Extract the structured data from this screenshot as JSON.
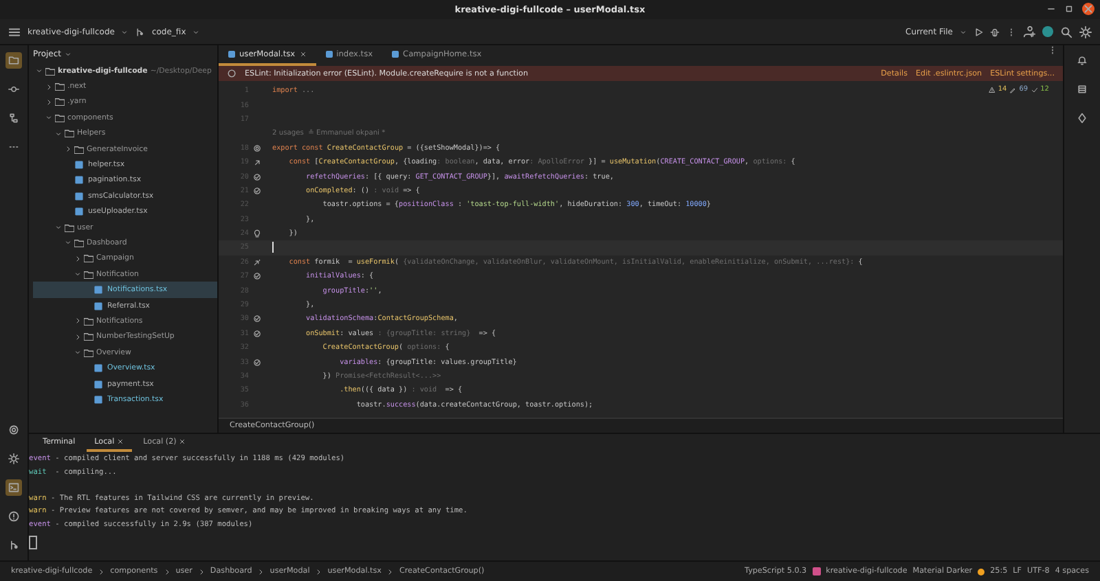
{
  "window": {
    "title": "kreative-digi-fullcode – userModal.tsx"
  },
  "toolbar": {
    "project": "kreative-digi-fullcode",
    "branch": "code_fix",
    "run_config": "Current File"
  },
  "project_panel": {
    "title": "Project",
    "tree": [
      {
        "name": "kreative-digi-fullcode",
        "path": "~/Desktop/Deep",
        "kind": "folder",
        "expanded": true,
        "selected": false,
        "children": [
          {
            "name": ".next",
            "kind": "folder",
            "expanded": false,
            "selected": false
          },
          {
            "name": ".yarn",
            "kind": "folder",
            "expanded": false,
            "selected": false
          },
          {
            "name": "components",
            "kind": "folder",
            "expanded": true,
            "selected": false,
            "children": [
              {
                "name": "Helpers",
                "kind": "folder",
                "expanded": true,
                "selected": false,
                "children": [
                  {
                    "name": "GenerateInvoice",
                    "kind": "folder",
                    "expanded": false,
                    "selected": false
                  },
                  {
                    "name": "helper.tsx",
                    "kind": "file",
                    "selected": false,
                    "modified": false
                  },
                  {
                    "name": "pagination.tsx",
                    "kind": "file",
                    "selected": false,
                    "modified": false
                  },
                  {
                    "name": "smsCalculator.tsx",
                    "kind": "file",
                    "selected": false,
                    "modified": false
                  },
                  {
                    "name": "useUploader.tsx",
                    "kind": "file",
                    "selected": false,
                    "modified": false
                  }
                ]
              },
              {
                "name": "user",
                "kind": "folder",
                "expanded": true,
                "selected": false,
                "children": [
                  {
                    "name": "Dashboard",
                    "kind": "folder",
                    "expanded": true,
                    "selected": false,
                    "children": [
                      {
                        "name": "Campaign",
                        "kind": "folder",
                        "expanded": false,
                        "selected": false
                      },
                      {
                        "name": "Notification",
                        "kind": "folder",
                        "expanded": true,
                        "selected": false,
                        "children": [
                          {
                            "name": "Notifications.tsx",
                            "kind": "file",
                            "selected": true,
                            "modified": true
                          },
                          {
                            "name": "Referral.tsx",
                            "kind": "file",
                            "selected": false,
                            "modified": false
                          }
                        ]
                      },
                      {
                        "name": "Notifications",
                        "kind": "folder",
                        "expanded": false,
                        "selected": false
                      },
                      {
                        "name": "NumberTestingSetUp",
                        "kind": "folder",
                        "expanded": false,
                        "selected": false
                      },
                      {
                        "name": "Overview",
                        "kind": "folder",
                        "expanded": true,
                        "selected": false,
                        "children": [
                          {
                            "name": "Overview.tsx",
                            "kind": "file",
                            "selected": false,
                            "modified": true
                          },
                          {
                            "name": "payment.tsx",
                            "kind": "file",
                            "selected": false,
                            "modified": false
                          },
                          {
                            "name": "Transaction.tsx",
                            "kind": "file",
                            "selected": false,
                            "modified": true
                          }
                        ]
                      }
                    ]
                  }
                ]
              }
            ]
          }
        ]
      }
    ]
  },
  "editor": {
    "tabs": [
      {
        "label": "userModal.tsx",
        "selected": true
      },
      {
        "label": "index.tsx",
        "selected": false
      },
      {
        "label": "CampaignHome.tsx",
        "selected": false
      }
    ],
    "banner": {
      "message": "ESLint: Initialization error (ESLint). Module.createRequire is not a function",
      "links": [
        "Details",
        "Edit .eslintrc.json",
        "ESLint settings..."
      ]
    },
    "inspections": {
      "warnings": "14",
      "typos": "69",
      "ok": "12"
    },
    "lines": [
      {
        "number": "1",
        "gutter": {
          "kind": "fold"
        },
        "tokens": [
          {
            "kind": "kw",
            "text": "import "
          },
          {
            "kind": "fold",
            "text": "..."
          }
        ]
      },
      {
        "number": "16"
      },
      {
        "number": "17"
      },
      {
        "kind": "usages",
        "tokens": [
          {
            "kind": "hint",
            "text": "2 usages  ≗ Emmanuel okpani *"
          }
        ]
      },
      {
        "number": "18",
        "gutter": {
          "kind": "ref"
        },
        "tokens": [
          {
            "kind": "kw",
            "text": "export const "
          },
          {
            "kind": "fn",
            "text": "CreateContactGroup"
          },
          {
            "kind": "plain",
            "text": " = ({setShowModal})=> {"
          }
        ]
      },
      {
        "number": "19",
        "gutter": {
          "kind": "up"
        },
        "tokens": [
          {
            "kind": "kw",
            "text": "    const "
          },
          {
            "kind": "plain",
            "text": "["
          },
          {
            "kind": "fn",
            "text": "CreateContactGroup"
          },
          {
            "kind": "plain",
            "text": ", {loading"
          },
          {
            "kind": "hint",
            "text": ": boolean"
          },
          {
            "kind": "plain",
            "text": ", data, error"
          },
          {
            "kind": "hint",
            "text": ": ApolloError"
          },
          {
            "kind": "plain",
            "text": " }] = "
          },
          {
            "kind": "fn",
            "text": "useMutation"
          },
          {
            "kind": "plain",
            "text": "("
          },
          {
            "kind": "const",
            "text": "CREATE_CONTACT_GROUP"
          },
          {
            "kind": "plain",
            "text": ", "
          },
          {
            "kind": "hint",
            "text": "options:"
          },
          {
            "kind": "plain",
            "text": " {"
          }
        ]
      },
      {
        "number": "20",
        "gutter": {
          "kind": "check"
        },
        "tokens": [
          {
            "kind": "prop",
            "text": "        refetchQueries"
          },
          {
            "kind": "plain",
            "text": ": [{ query: "
          },
          {
            "kind": "const",
            "text": "GET_CONTACT_GROUP"
          },
          {
            "kind": "plain",
            "text": "}], "
          },
          {
            "kind": "prop",
            "text": "awaitRefetchQueries"
          },
          {
            "kind": "plain",
            "text": ": true,"
          }
        ]
      },
      {
        "number": "21",
        "gutter": {
          "kind": "check"
        },
        "tokens": [
          {
            "kind": "fn",
            "text": "        onCompleted"
          },
          {
            "kind": "plain",
            "text": ": () "
          },
          {
            "kind": "hint",
            "text": ": void"
          },
          {
            "kind": "plain",
            "text": " => {"
          }
        ]
      },
      {
        "number": "22",
        "tokens": [
          {
            "kind": "plain",
            "text": "            toastr.options = {"
          },
          {
            "kind": "prop",
            "text": "positionClass"
          },
          {
            "kind": "plain",
            "text": " : "
          },
          {
            "kind": "str",
            "text": "'toast-top-full-width'"
          },
          {
            "kind": "plain",
            "text": ", hideDuration: "
          },
          {
            "kind": "num",
            "text": "300"
          },
          {
            "kind": "plain",
            "text": ", timeOut: "
          },
          {
            "kind": "num",
            "text": "10000"
          },
          {
            "kind": "plain",
            "text": "}"
          }
        ]
      },
      {
        "number": "23",
        "tokens": [
          {
            "kind": "plain",
            "text": "        },"
          }
        ]
      },
      {
        "number": "24",
        "gutter": {
          "kind": "bulb"
        },
        "tokens": [
          {
            "kind": "plain",
            "text": "    })"
          }
        ]
      },
      {
        "number": "25",
        "current": true
      },
      {
        "number": "26",
        "gutter": {
          "kind": "link"
        },
        "tokens": [
          {
            "kind": "kw",
            "text": "    const "
          },
          {
            "kind": "plain",
            "text": "formik  = "
          },
          {
            "kind": "fn",
            "text": "useFormik"
          },
          {
            "kind": "plain",
            "text": "( "
          },
          {
            "kind": "hint",
            "text": "{validateOnChange, validateOnBlur, validateOnMount, isInitialValid, enableReinitialize, onSubmit, ...rest}:"
          },
          {
            "kind": "plain",
            "text": " {"
          }
        ]
      },
      {
        "number": "27",
        "gutter": {
          "kind": "check"
        },
        "tokens": [
          {
            "kind": "prop",
            "text": "        initialValues"
          },
          {
            "kind": "plain",
            "text": ": {"
          }
        ]
      },
      {
        "number": "28",
        "tokens": [
          {
            "kind": "prop",
            "text": "            groupTitle"
          },
          {
            "kind": "plain",
            "text": ":"
          },
          {
            "kind": "str",
            "text": "''"
          },
          {
            "kind": "plain",
            "text": ","
          }
        ]
      },
      {
        "number": "29",
        "tokens": [
          {
            "kind": "plain",
            "text": "        },"
          }
        ]
      },
      {
        "number": "30",
        "gutter": {
          "kind": "check"
        },
        "tokens": [
          {
            "kind": "prop",
            "text": "        validationSchema"
          },
          {
            "kind": "plain",
            "text": ":"
          },
          {
            "kind": "fn",
            "text": "ContactGroupSchema"
          },
          {
            "kind": "plain",
            "text": ","
          }
        ]
      },
      {
        "number": "31",
        "gutter": {
          "kind": "check"
        },
        "tokens": [
          {
            "kind": "fn",
            "text": "        onSubmit"
          },
          {
            "kind": "plain",
            "text": ": values "
          },
          {
            "kind": "hint",
            "text": ": {groupTitle: string}"
          },
          {
            "kind": "plain",
            "text": "  => {"
          }
        ]
      },
      {
        "number": "32",
        "tokens": [
          {
            "kind": "fn",
            "text": "            CreateContactGroup"
          },
          {
            "kind": "plain",
            "text": "( "
          },
          {
            "kind": "hint",
            "text": "options:"
          },
          {
            "kind": "plain",
            "text": " {"
          }
        ]
      },
      {
        "number": "33",
        "gutter": {
          "kind": "check"
        },
        "tokens": [
          {
            "kind": "prop",
            "text": "                variables"
          },
          {
            "kind": "plain",
            "text": ": {groupTitle: values.groupTitle}"
          }
        ]
      },
      {
        "number": "34",
        "tokens": [
          {
            "kind": "plain",
            "text": "            }) "
          },
          {
            "kind": "hint",
            "text": "Promise<FetchResult<...>>"
          }
        ]
      },
      {
        "number": "35",
        "tokens": [
          {
            "kind": "fn",
            "text": "                .then"
          },
          {
            "kind": "plain",
            "text": "(({ data }) "
          },
          {
            "kind": "hint",
            "text": ": void"
          },
          {
            "kind": "plain",
            "text": "  => {"
          }
        ]
      },
      {
        "number": "36",
        "tokens": [
          {
            "kind": "plain",
            "text": "                    toastr."
          },
          {
            "kind": "prop",
            "text": "success"
          },
          {
            "kind": "plain",
            "text": "(data.createContactGroup, toastr.options);"
          }
        ]
      }
    ],
    "breadcrumb": "CreateContactGroup()"
  },
  "terminal": {
    "tabs": [
      {
        "label": "Terminal",
        "kind": "title",
        "selected": false
      },
      {
        "label": "Local",
        "kind": "session",
        "selected": true
      },
      {
        "label": "Local (2)",
        "kind": "session",
        "selected": false
      }
    ],
    "lines": [
      {
        "kind": "event",
        "prefix": "event",
        "text": " - compiled client and server successfully in 1188 ms (429 modules)"
      },
      {
        "kind": "wait",
        "prefix": "wait",
        "text": "  - compiling..."
      },
      {
        "kind": "blank"
      },
      {
        "kind": "warn",
        "prefix": "warn",
        "text": " - The RTL features in Tailwind CSS are currently in preview."
      },
      {
        "kind": "warn",
        "prefix": "warn",
        "text": " - Preview features are not covered by semver, and may be improved in breaking ways at any time."
      },
      {
        "kind": "event",
        "prefix": "event",
        "text": " - compiled successfully in 2.9s (387 modules)"
      }
    ]
  },
  "status_bar": {
    "breadcrumbs": [
      "kreative-digi-fullcode",
      "components",
      "user",
      "Dashboard",
      "userModal",
      "userModal.tsx",
      "CreateContactGroup()"
    ],
    "language": "TypeScript 5.0.3",
    "project": "kreative-digi-fullcode",
    "theme": "Material Darker",
    "position": "25:5",
    "line_ending": "LF",
    "encoding": "UTF-8",
    "indent": "4 spaces"
  }
}
